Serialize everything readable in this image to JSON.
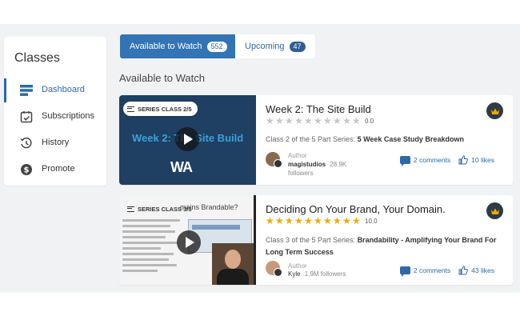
{
  "sidebar": {
    "title": "Classes",
    "items": [
      {
        "label": "Dashboard",
        "active": true
      },
      {
        "label": "Subscriptions"
      },
      {
        "label": "History"
      },
      {
        "label": "Promote"
      }
    ]
  },
  "tabs": [
    {
      "label": "Available to Watch",
      "count": "552"
    },
    {
      "label": "Upcoming",
      "count": "47"
    }
  ],
  "section_heading": "Available to Watch",
  "cards": [
    {
      "series": "SERIES CLASS 2/5",
      "thumb_title": "Week 2: The Site Build",
      "thumb_logo": "WA",
      "title": "Week 2: The Site Build",
      "rating": "0.0",
      "rating_fraction": 0,
      "desc_prefix": "Class 2 of the 5 Part Series: ",
      "desc_bold": "5 Week Case Study Breakdown",
      "author_label": "Author",
      "author_name": "magistudios",
      "followers": "28.9K followers",
      "comments": "2 comments",
      "likes": "10 likes"
    },
    {
      "series": "SERIES CLASS 3/5",
      "thumb_title": "mains Brandable?",
      "title": "Deciding On Your Brand, Your Domain.",
      "rating": "10.0",
      "rating_fraction": 1,
      "desc_prefix": "Class 3 of the 5 Part Series: ",
      "desc_bold": "Brandability - Amplifying Your Brand For Long Term Success",
      "author_label": "Author",
      "author_name": "Kyle",
      "followers": "1.9M followers",
      "comments": "2 comments",
      "likes": "43 likes"
    }
  ],
  "colors": {
    "accent": "#3274b4",
    "star": "#f0a900",
    "link": "#2c6aa8"
  },
  "icons": {
    "nav": [
      "dashboard-icon",
      "calendar-check-icon",
      "history-icon",
      "dollar-coin-icon"
    ],
    "premium": "crown-icon"
  }
}
